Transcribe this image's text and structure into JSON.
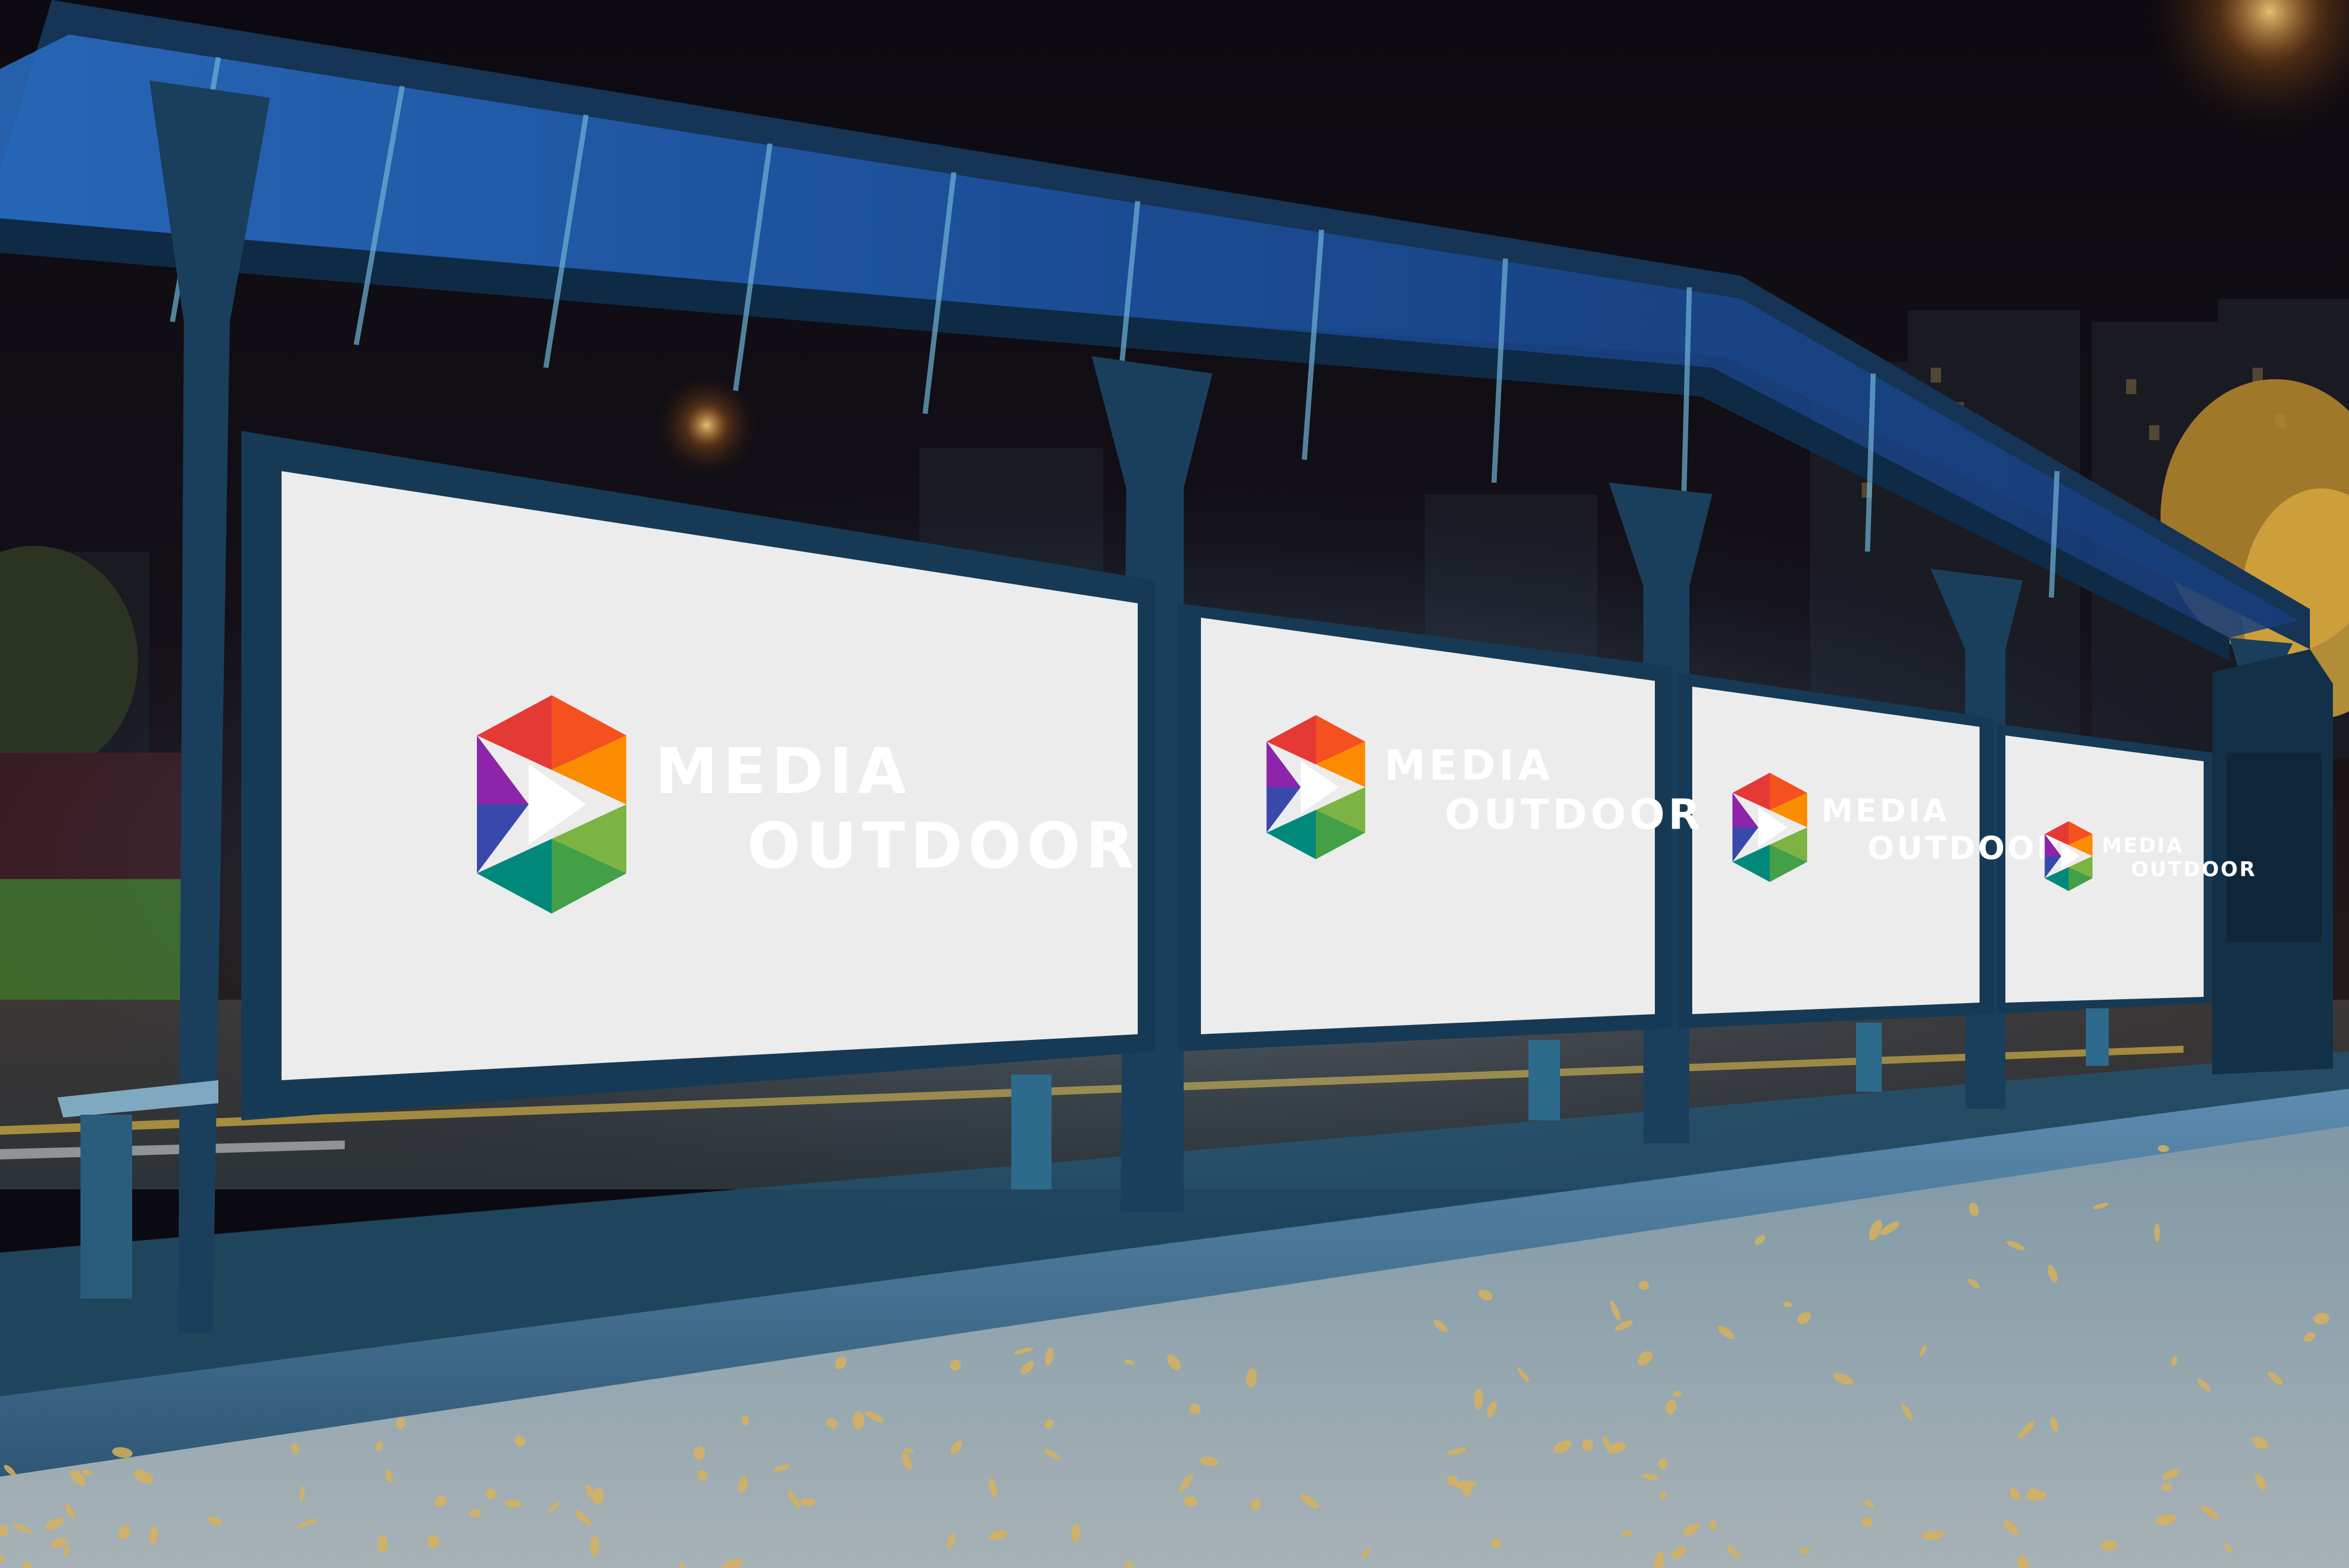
{
  "scene": {
    "subject": "bus-stop-shelter-at-night",
    "colors": {
      "sky": "#0d0b12",
      "roof_glass": "#1e4f9a",
      "frame_steel": "#1d5f86",
      "board_face": "#ececec",
      "road": "#3a3f45",
      "pavement": "#8fa4b0",
      "foliage": "#d1a23a"
    }
  },
  "billboards": [
    {
      "brand": {
        "line1": "MEDIA",
        "line2": "OUTDOOR"
      }
    },
    {
      "brand": {
        "line1": "MEDIA",
        "line2": "OUTDOOR"
      }
    },
    {
      "brand": {
        "line1": "MEDIA",
        "line2": "OUTDOOR"
      }
    },
    {
      "brand": {
        "line1": "MEDIA",
        "line2": "OUTDOOR"
      }
    }
  ],
  "logo": {
    "icon": "play-triangle-logo",
    "colors": [
      "#e53935",
      "#f4511e",
      "#fb8c00",
      "#7cb342",
      "#43a047",
      "#00897b",
      "#3949ab",
      "#8e24aa"
    ]
  }
}
